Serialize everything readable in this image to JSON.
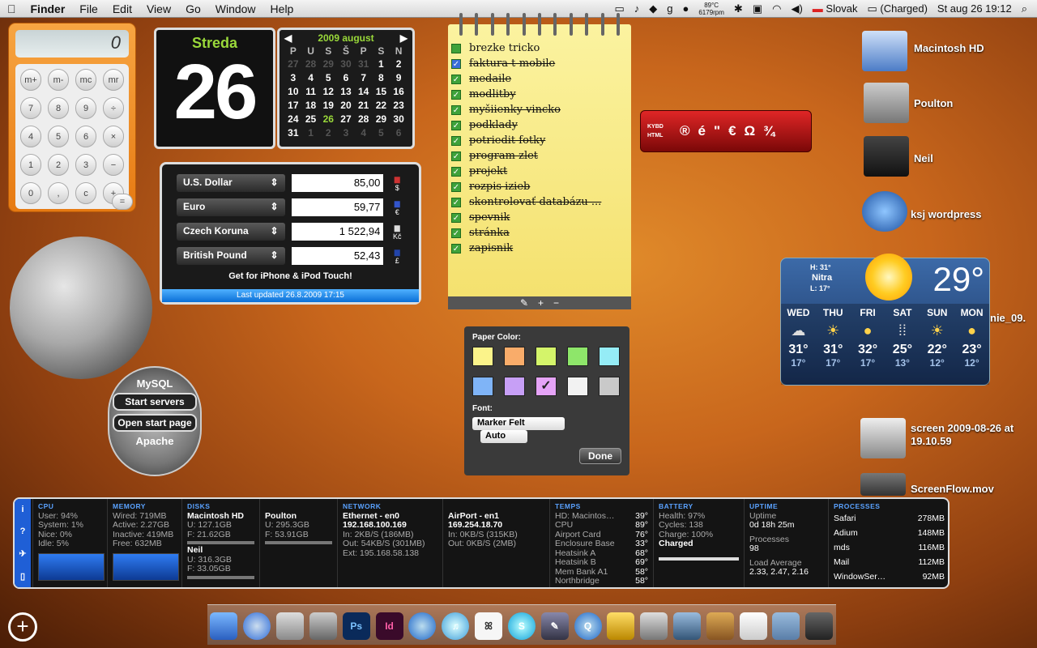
{
  "menubar": {
    "apple": "",
    "items": [
      "Finder",
      "File",
      "Edit",
      "View",
      "Go",
      "Window",
      "Help"
    ],
    "temp": "89°C",
    "rpm": "6179rpm",
    "language": "Slovak",
    "battery": "(Charged)",
    "datetime": "St aug 26  19:12"
  },
  "calculator": {
    "display": "0",
    "keys": [
      "m+",
      "m-",
      "mc",
      "mr",
      "÷",
      "7",
      "8",
      "9",
      "×",
      "4",
      "5",
      "6",
      "−",
      "1",
      "2",
      "3",
      "+",
      "0",
      ",",
      "c",
      "="
    ]
  },
  "flipclock": {
    "day_name": "Streda",
    "day_number": "26"
  },
  "calendar": {
    "title": "2009 august",
    "weekdays": [
      "P",
      "U",
      "S",
      "Š",
      "P",
      "S",
      "N"
    ],
    "weeks": [
      [
        "27",
        "28",
        "29",
        "30",
        "31",
        "1",
        "2"
      ],
      [
        "3",
        "4",
        "5",
        "6",
        "7",
        "8",
        "9"
      ],
      [
        "10",
        "11",
        "12",
        "13",
        "14",
        "15",
        "16"
      ],
      [
        "17",
        "18",
        "19",
        "20",
        "21",
        "22",
        "23"
      ],
      [
        "24",
        "25",
        "26",
        "27",
        "28",
        "29",
        "30"
      ],
      [
        "31",
        "1",
        "2",
        "3",
        "4",
        "5",
        "6"
      ]
    ]
  },
  "currency": {
    "rows": [
      {
        "name": "U.S. Dollar",
        "value": "85,00",
        "flag": "$"
      },
      {
        "name": "Euro",
        "value": "59,77",
        "flag": "€"
      },
      {
        "name": "Czech Koruna",
        "value": "1 522,94",
        "flag": "Kč"
      },
      {
        "name": "British Pound",
        "value": "52,43",
        "flag": "£"
      }
    ],
    "promo": "Get for iPhone & iPod Touch!",
    "updated": "Last updated 26.8.2009 17:15"
  },
  "mysql": {
    "title": "MySQL",
    "start": "Start servers",
    "open": "Open start page",
    "apache": "Apache"
  },
  "notes": {
    "items": [
      {
        "text": "brezke tricko",
        "done": false
      },
      {
        "text": "faktura t-mobile",
        "done": true
      },
      {
        "text": "medaile",
        "done": true
      },
      {
        "text": "modlitby",
        "done": true
      },
      {
        "text": "myšiienky vincko",
        "done": true
      },
      {
        "text": "podklady",
        "done": true
      },
      {
        "text": "potriedit fotky",
        "done": true
      },
      {
        "text": "program zlet",
        "done": true
      },
      {
        "text": "projekt",
        "done": true
      },
      {
        "text": "rozpis izieb",
        "done": true
      },
      {
        "text": "skontrolovať databázu ...",
        "done": true
      },
      {
        "text": "spevnik",
        "done": true
      },
      {
        "text": "stránka",
        "done": true
      },
      {
        "text": "zapisnik",
        "done": true
      }
    ]
  },
  "prefs": {
    "paper_label": "Paper Color:",
    "colors": [
      "#fbf38a",
      "#f9ac6a",
      "#d4f46a",
      "#8ee66a",
      "#95ecf6",
      "#7fb4f7",
      "#c79ff6",
      "#e5a3f6",
      "#f2f2f2",
      "#c9c9c9"
    ],
    "font_label": "Font:",
    "font": "Marker Felt",
    "size": "Auto",
    "done": "Done"
  },
  "kybd": {
    "label1": "KYBD",
    "label2": "HTML",
    "chars": [
      "®",
      "é",
      "\"",
      "€",
      "Ω",
      "¾"
    ]
  },
  "desktop": [
    {
      "label": "Macintosh HD"
    },
    {
      "label": "Poulton"
    },
    {
      "label": "Neil"
    },
    {
      "label": "ksj wordpress"
    },
    {
      "label": "nie_09."
    },
    {
      "label": "screen 2009-08-26 at"
    },
    {
      "label": "19.10.59"
    },
    {
      "label": "ScreenFlow.mov"
    }
  ],
  "weather": {
    "hi": "H: 31°",
    "city": "Nitra",
    "lo": "L: 17°",
    "current": "29°",
    "days": [
      {
        "d": "WED",
        "hi": "31°",
        "lo": "17°"
      },
      {
        "d": "THU",
        "hi": "31°",
        "lo": "17°"
      },
      {
        "d": "FRI",
        "hi": "32°",
        "lo": "17°"
      },
      {
        "d": "SAT",
        "hi": "25°",
        "lo": "13°"
      },
      {
        "d": "SUN",
        "hi": "22°",
        "lo": "12°"
      },
      {
        "d": "MON",
        "hi": "23°",
        "lo": "12°"
      }
    ]
  },
  "istat": {
    "cpu": {
      "h": "CPU",
      "user": "User: 94%",
      "system": "System: 1%",
      "nice": "Nice: 0%",
      "idle": "Idle: 5%"
    },
    "memory": {
      "h": "MEMORY",
      "wired": "Wired: 719MB",
      "active": "Active: 2.27GB",
      "inactive": "Inactive: 419MB",
      "free": "Free: 632MB"
    },
    "disks": {
      "h": "DISKS",
      "d1": "Macintosh HD",
      "d1u": "U: 127.1GB",
      "d1f": "F: 21.62GB",
      "d2": "Neil",
      "d2u": "U: 316.3GB",
      "d2f": "F: 33.05GB",
      "d3": "Poulton",
      "d3u": "U: 295.3GB",
      "d3f": "F: 53.91GB"
    },
    "network": {
      "h": "NETWORK",
      "if1": "Ethernet - en0",
      "ip1": "192.168.100.169",
      "in1": "In: 2KB/S (186MB)",
      "out1": "Out: 54KB/S (301MB)",
      "ext": "Ext: 195.168.58.138",
      "if2": "AirPort - en1",
      "ip2": "169.254.18.70",
      "in2": "In: 0KB/S (315KB)",
      "out2": "Out: 0KB/S (2MB)"
    },
    "temps": {
      "h": "TEMPS",
      "rows": [
        [
          "HD: Macintos…",
          "39°"
        ],
        [
          "CPU",
          "89°"
        ],
        [
          "Airport Card",
          "76°"
        ],
        [
          "Enclosure Base",
          "33°"
        ],
        [
          "Heatsink A",
          "68°"
        ],
        [
          "Heatsink B",
          "69°"
        ],
        [
          "Mem Bank A1",
          "58°"
        ],
        [
          "Northbridge",
          "58°"
        ]
      ]
    },
    "battery": {
      "h": "BATTERY",
      "health": "Health: 97%",
      "cycles": "Cycles: 138",
      "charge": "Charge: 100%",
      "state": "Charged"
    },
    "uptime": {
      "h": "UPTIME",
      "l1": "Uptime",
      "v1": "0d 18h 25m",
      "l2": "Processes",
      "v2": "98",
      "l3": "Load Average",
      "v3": "2.33, 2.47, 2.16"
    },
    "processes": {
      "h": "PROCESSES",
      "rows": [
        [
          "Safari",
          "278MB"
        ],
        [
          "Adium",
          "148MB"
        ],
        [
          "mds",
          "116MB"
        ],
        [
          "Mail",
          "112MB"
        ],
        [
          "WindowSer…",
          "92MB"
        ]
      ]
    }
  },
  "dock": [
    "Finder",
    "Safari",
    "Mail",
    "iCal",
    "Ps",
    "Id",
    "QT",
    "iTunes",
    "Miffy",
    "Skype",
    "Photo",
    "QT2",
    "Transmit",
    "Preview",
    "iPhoto",
    "Horse",
    "TextEdit",
    "Docs",
    "Trash"
  ]
}
